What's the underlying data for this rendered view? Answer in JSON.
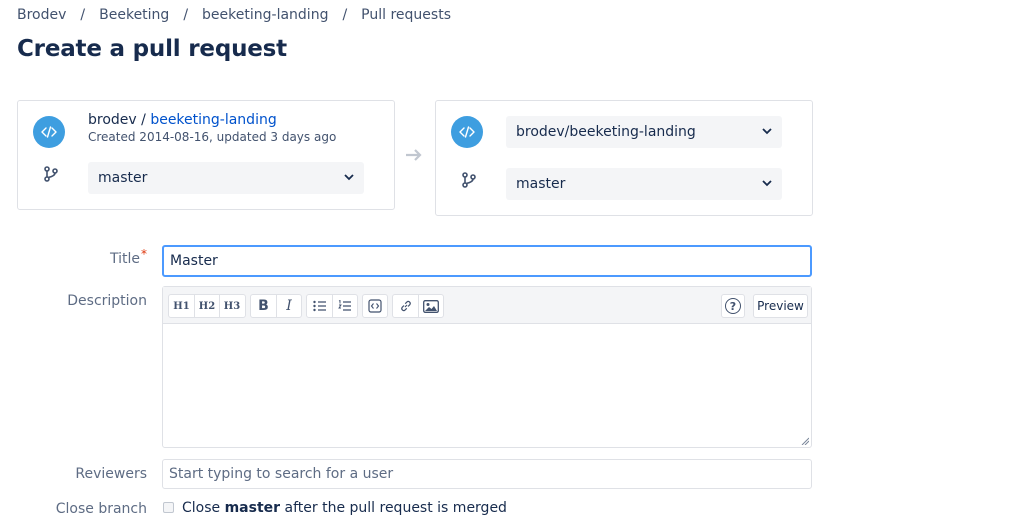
{
  "breadcrumb": [
    "Brodev",
    "Beeketing",
    "beeketing-landing",
    "Pull requests"
  ],
  "breadcrumb_sep": "/",
  "page": {
    "title": "Create a pull request"
  },
  "source": {
    "owner": "brodev",
    "owner_sep": " / ",
    "repo": "beeketing-landing",
    "meta": "Created 2014-08-16, updated 3 days ago",
    "branch": "master"
  },
  "destination": {
    "repo": "brodev/beeketing-landing",
    "branch": "master"
  },
  "form": {
    "title_label": "Title",
    "title_required": "*",
    "title_value": "Master",
    "description_label": "Description",
    "toolbar": {
      "h1": "H1",
      "h2": "H2",
      "h3": "H3",
      "bold": "B",
      "italic": "I",
      "help": "?",
      "preview": "Preview"
    },
    "description_value": "",
    "reviewers_label": "Reviewers",
    "reviewers_placeholder": "Start typing to search for a user",
    "close_branch_label": "Close branch",
    "close_branch_text_pre": "Close ",
    "close_branch_branch": "master",
    "close_branch_text_post": " after the pull request is merged",
    "close_branch_checked": false
  },
  "colors": {
    "accent": "#0052cc",
    "repo_icon_bg": "#3e9ee0",
    "focus_border": "#4c9aff",
    "required": "#de350b"
  },
  "icons": [
    "repo-code-icon",
    "branch-icon",
    "chevron-down-icon",
    "arrow-right-icon",
    "bullet-list-icon",
    "numbered-list-icon",
    "code-icon",
    "link-icon",
    "image-icon",
    "help-icon"
  ]
}
